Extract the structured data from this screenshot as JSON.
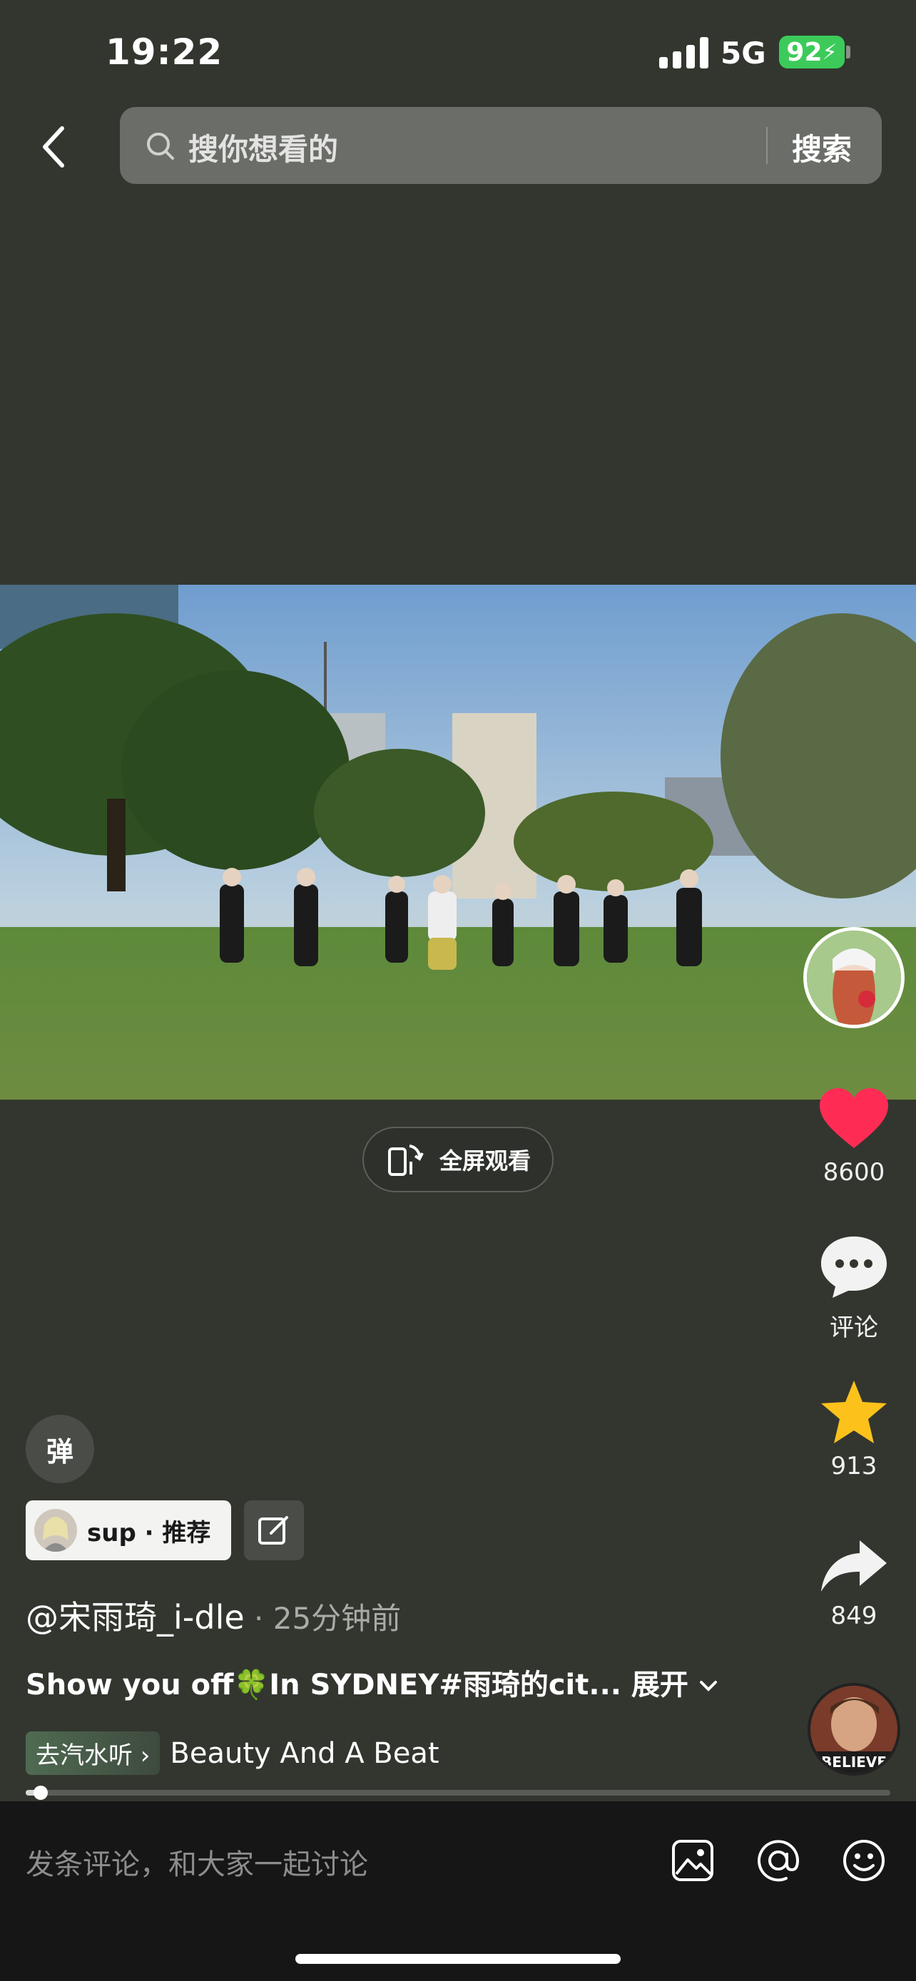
{
  "status_bar": {
    "time": "19:22",
    "network": "5G",
    "battery": "92"
  },
  "search": {
    "placeholder": "搜你想看的",
    "button_label": "搜索"
  },
  "video": {
    "fullscreen_label": "全屏观看"
  },
  "actions": {
    "likes": "8600",
    "comments_label": "评论",
    "favorites": "913",
    "shares": "849"
  },
  "danmu_label": "弹",
  "recommend": {
    "label": "sup · 推荐"
  },
  "post": {
    "author": "@宋雨琦_i-dle",
    "separator": " · ",
    "time_ago": "25分钟前",
    "caption": "Show you off🍀In SYDNEY#雨琦的cit...",
    "expand_label": "展开"
  },
  "music": {
    "tag": "去汽水听 ›",
    "title": "Beauty And A Beat",
    "album_text": "BELIEVE"
  },
  "playback": {
    "progress": 0.014
  },
  "comment_bar": {
    "placeholder": "发条评论，和大家一起讨论"
  },
  "icons": [
    "back-icon",
    "search-icon",
    "fullscreen-rotate-icon",
    "heart-icon",
    "comment-icon",
    "star-icon",
    "share-icon",
    "edit-icon",
    "image-icon",
    "at-icon",
    "emoji-icon"
  ],
  "colors": {
    "like": "#fe2c55",
    "favorite": "#fcc21b",
    "battery": "#3ccb5a",
    "background": "#33362f"
  }
}
